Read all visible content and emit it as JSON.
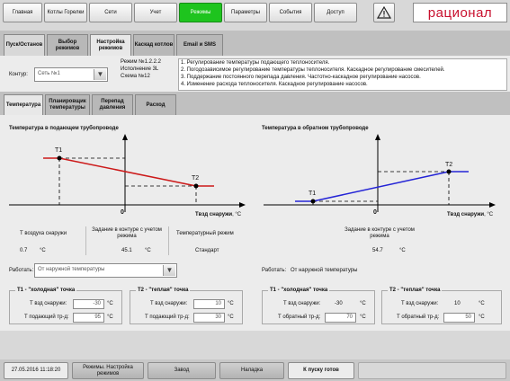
{
  "top_nav": {
    "items": [
      "Главная",
      "Котлы Горелки",
      "Сети",
      "Учет",
      "Режимы",
      "Параметры",
      "События",
      "Доступ"
    ],
    "active": "Режимы",
    "warning_icon": "warning-icon",
    "brand": "рационал",
    "brand_color": "#c8102e",
    "active_color": "#1ec41e"
  },
  "sub_nav": {
    "items": [
      "Пуск/Останов",
      "Выбор режимов",
      "Настройка режимов",
      "Каскад котлов",
      "Email и SMS"
    ],
    "active": "Настройка режимов"
  },
  "circuit": {
    "label": "Контур:",
    "value": "Сеть №1",
    "mode_info": [
      "Режим №1.2.2.2",
      "Исполнение 3L",
      "Схема №12"
    ],
    "descriptions": [
      "1. Регулирование температуры подающего теплоносителя.",
      "2. Погодозависимое регулирование температуры теплоносителя. Каскадное регулирование смесителей.",
      "3. Поддержание постоянного перепада давления. Частотно-каскадное регулирование насосов.",
      "4. Изменение расхода теплоносителя. Каскадное регулирование насосов."
    ]
  },
  "param_tabs": {
    "items": [
      "Температура",
      "Планировщик температуры",
      "Перепад давления",
      "Расход"
    ],
    "active": "Температура"
  },
  "left_chart": {
    "title": "Температура в подающем трубопроводе",
    "t1": "T1",
    "t2": "T2",
    "zero": "0",
    "axis": "Tвзд снаружи",
    "axis_unit": ", °C",
    "line_color": "#cc1a1a"
  },
  "right_chart": {
    "title": "Температура в обратном трубопроводе",
    "t1": "T1",
    "t2": "T2",
    "zero": "0",
    "axis": "Tвзд снаружи",
    "axis_unit": ", °C",
    "line_color": "#2424d6"
  },
  "left_info": {
    "col1_header": "Т воздуха снаружи",
    "col2_header": "Задание в контуре с учетом режима",
    "col3_header": "Температурный режим",
    "col1_value": "0.7",
    "col1_unit": "°C",
    "col2_value": "45.1",
    "col2_unit": "°C",
    "col3_value": "Стандарт"
  },
  "right_info": {
    "header": "Задание в контуре с учетом режима",
    "value": "54.7",
    "unit": "°C"
  },
  "work_left": {
    "label": "Работать:",
    "value": "От наружной температуры"
  },
  "work_right": {
    "label": "Работать:",
    "value": "От наружной температуры"
  },
  "left_cold": {
    "title": "T1 - \"холодная\" точка",
    "row1_label": "Т взд снаружи:",
    "row1_value": "-30",
    "row2_label": "Т подающий тр-д:",
    "row2_value": "95",
    "unit": "°C"
  },
  "left_warm": {
    "title": "T2 - \"теплая\" точка",
    "row1_label": "Т взд снаружи:",
    "row1_value": "10",
    "row2_label": "Т подающий тр-д:",
    "row2_value": "30",
    "unit": "°C"
  },
  "right_cold": {
    "title": "T1 - \"холодная\" точка",
    "row1_label": "Т взд снаружи:",
    "row1_value": "-30",
    "row2_label": "Т обратный тр-д:",
    "row2_value": "70",
    "unit": "°C"
  },
  "right_warm": {
    "title": "T2 - \"теплая\" точка",
    "row1_label": "Т взд снаружи:",
    "row1_value": "10",
    "row2_label": "Т обратный тр-д:",
    "row2_value": "50",
    "unit": "°C"
  },
  "status_bar": {
    "datetime": "27.05.2016 11:18:20",
    "mode": "Режимы. Настройка режимов",
    "plant": "Завод",
    "setup": "Наладка",
    "ready": "К пуску готов"
  }
}
